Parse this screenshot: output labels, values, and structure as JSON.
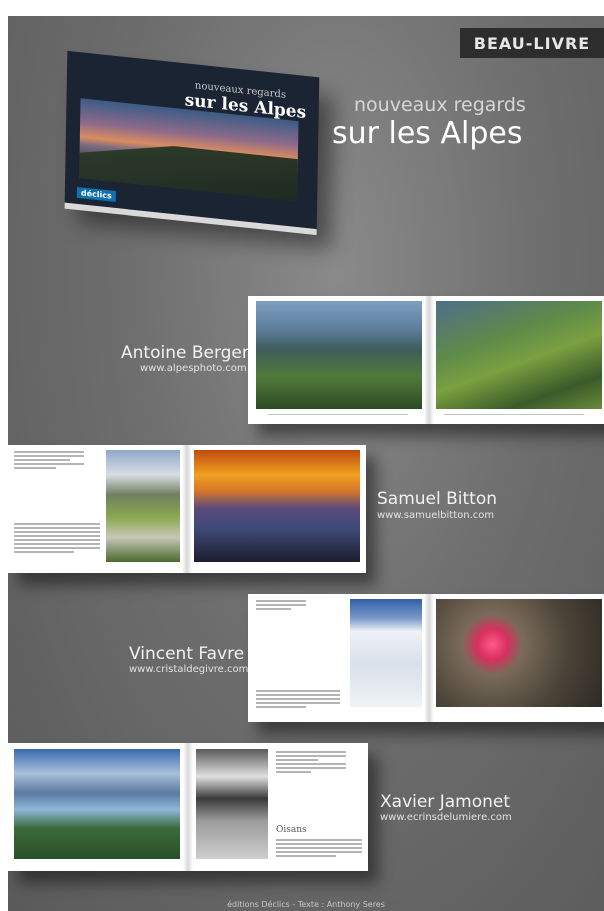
{
  "badge": "BEAU-LIVRE",
  "book": {
    "cover_line1": "nouveaux regards",
    "cover_line2": "sur les Alpes",
    "publisher_logo": "déclics"
  },
  "title": {
    "line1": "nouveaux regards",
    "line2": "sur les Alpes"
  },
  "photographers": [
    {
      "name": "Antoine Berger",
      "url": "www.alpesphoto.com"
    },
    {
      "name": "Samuel Bitton",
      "url": "www.samuelbitton.com"
    },
    {
      "name": "Vincent Favre",
      "url": "www.cristaldegivre.com"
    },
    {
      "name": "Xavier Jamonet",
      "url": "www.ecrinsdelumiere.com"
    }
  ],
  "spread4_heading": "Oisans",
  "footer": "éditions Déclics - Texte : Anthony Seres"
}
